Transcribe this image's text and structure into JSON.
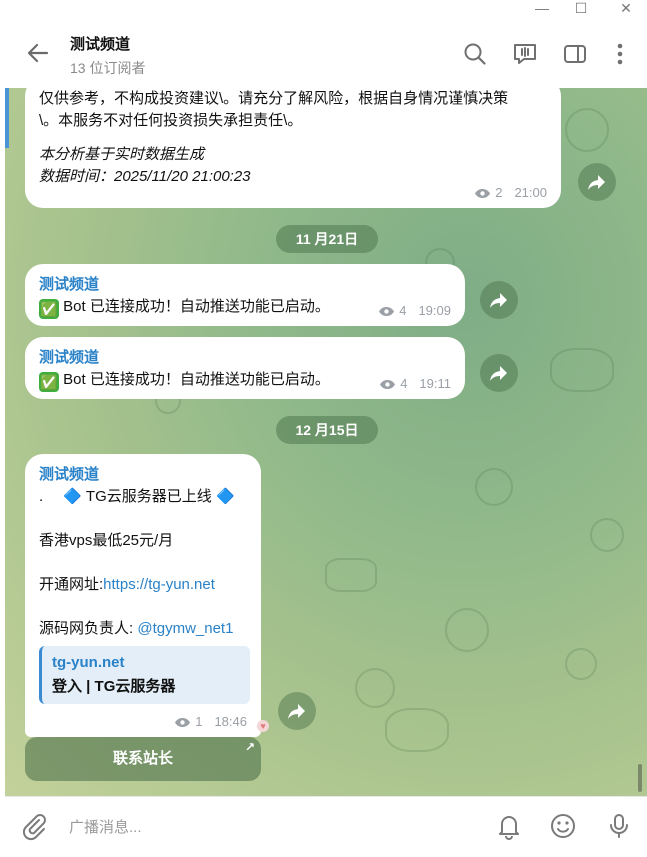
{
  "window": {
    "minimize": "—",
    "maximize": "☐",
    "close": "✕"
  },
  "header": {
    "title": "测试频道",
    "subtitle": "13 位订阅者",
    "icons": [
      "back-arrow-icon",
      "search-icon",
      "discussion-icon",
      "sidebar-toggle-icon",
      "more-vertical-icon"
    ]
  },
  "messages": {
    "m1": {
      "line1": "仅供参考，不构成投资建议\\。请充分了解风险，根据自身情况谨慎决策",
      "line2": "\\。本服务不对任何投资损失承担责任\\。",
      "line3": "本分析基于实时数据生成",
      "line4": "数据时间：2025/11/20 21:00:23",
      "views": "2",
      "time": "21:00"
    },
    "date1": "11 月21日",
    "m2": {
      "sender": "测试频道",
      "emoji": "✅",
      "text": " Bot 已连接成功！自动推送功能已启动。",
      "views": "4",
      "time": "19:09"
    },
    "m3": {
      "sender": "测试频道",
      "emoji": "✅",
      "text": " Bot 已连接成功！自动推送功能已启动。",
      "views": "4",
      "time": "19:11"
    },
    "date2": "12 月15日",
    "m4": {
      "sender": "测试频道",
      "line1_prefix": ".",
      "line1_diamond_left": "🔷",
      "line1_text": " TG云服务器已上线 ",
      "line1_diamond_right": "🔷",
      "line2": "香港vps最低25元/月",
      "line3_label": "开通网址:",
      "line3_link": "https://tg-yun.net",
      "line4_label": "源码网负责人: ",
      "line4_link": "@tgymw_net1",
      "preview_site": "tg-yun.net",
      "preview_title": "登入 | TG云服务器",
      "views": "1",
      "time": "18:46"
    },
    "button": {
      "label": "联系站长",
      "arrow": "↗"
    }
  },
  "input": {
    "placeholder": "广播消息...",
    "icons": [
      "attach-icon",
      "bell-icon",
      "emoji-icon",
      "microphone-icon"
    ]
  },
  "colors": {
    "accent": "#2a82c8",
    "chat_bg": "#9dbe8c",
    "date_pill": "#6f9a6e"
  }
}
